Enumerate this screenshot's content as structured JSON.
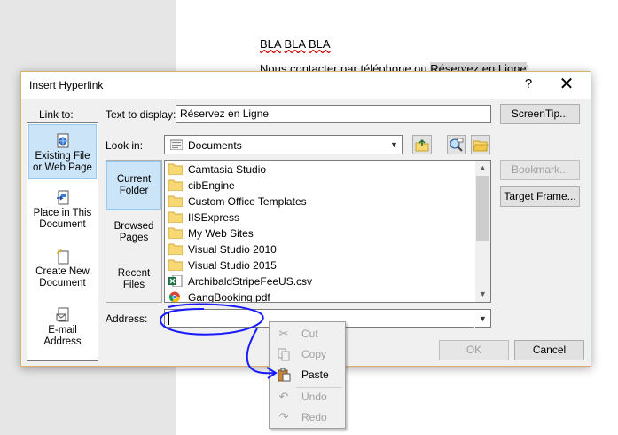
{
  "document": {
    "line1": [
      "BLA",
      "BLA",
      "BLA"
    ],
    "line2_prefix": "Nous contacter par téléphone ou ",
    "line2_highlight": "Réservez en Ligne",
    "line2_suffix": "!"
  },
  "dialog": {
    "title": "Insert Hyperlink",
    "help_label": "?",
    "close_label": "✕",
    "link_to_label": "Link to:",
    "link_to_items": [
      {
        "line1": "Existing File",
        "line2": "or Web Page",
        "icon": "web-page-icon"
      },
      {
        "line1": "Place in This",
        "line2": "Document",
        "icon": "place-in-document-icon"
      },
      {
        "line1": "Create New",
        "line2": "Document",
        "icon": "new-document-icon"
      },
      {
        "line1": "E-mail",
        "line2": "Address",
        "icon": "email-icon"
      }
    ],
    "text_to_display_label": "Text to display:",
    "text_to_display_value": "Réservez en Ligne",
    "screentip_label": "ScreenTip...",
    "look_in_label": "Look in:",
    "look_in_value": "Documents",
    "places": [
      {
        "line1": "Current",
        "line2": "Folder"
      },
      {
        "line1": "Browsed",
        "line2": "Pages"
      },
      {
        "line1": "Recent",
        "line2": "Files"
      }
    ],
    "files": [
      {
        "name": "Camtasia Studio",
        "icon": "folder-icon"
      },
      {
        "name": "cibEngine",
        "icon": "folder-icon"
      },
      {
        "name": "Custom Office Templates",
        "icon": "folder-icon"
      },
      {
        "name": "IISExpress",
        "icon": "folder-icon"
      },
      {
        "name": "My Web Sites",
        "icon": "folder-icon"
      },
      {
        "name": "Visual Studio 2010",
        "icon": "folder-icon"
      },
      {
        "name": "Visual Studio 2015",
        "icon": "folder-icon"
      },
      {
        "name": "ArchibaldStripeFeeUS.csv",
        "icon": "excel-file-icon"
      },
      {
        "name": "GangBooking.pdf",
        "icon": "chrome-file-icon"
      }
    ],
    "bookmark_label": "Bookmark...",
    "target_frame_label": "Target Frame...",
    "address_label": "Address:",
    "address_value": "",
    "ok_label": "OK",
    "cancel_label": "Cancel"
  },
  "context_menu": {
    "items": [
      {
        "label": "Cut",
        "icon": "scissors-icon",
        "enabled": false
      },
      {
        "label": "Copy",
        "icon": "copy-icon",
        "enabled": false
      },
      {
        "label": "Paste",
        "icon": "paste-icon",
        "enabled": true
      },
      {
        "label": "Undo",
        "icon": "undo-icon",
        "enabled": false
      },
      {
        "label": "Redo",
        "icon": "redo-icon",
        "enabled": false
      }
    ]
  },
  "colors": {
    "annotation": "#1a1aff",
    "selection_bg": "#cce4f7",
    "folder_yellow": "#f8d775",
    "dialog_border": "#d8b26a"
  }
}
